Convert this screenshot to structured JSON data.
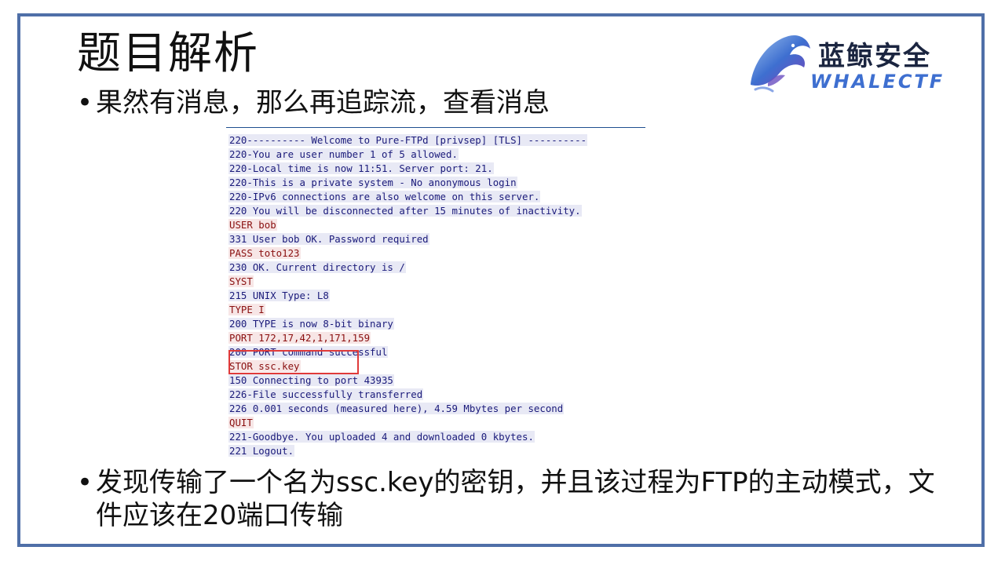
{
  "slide": {
    "title": "题目解析",
    "bullet1": "果然有消息，那么再追踪流，查看消息",
    "bullet2": "发现传输了一个名为ssc.key的密钥，并且该过程为FTP的主动模式，文件应该在20端口传输",
    "bullet_marker": "•"
  },
  "logo": {
    "cn": "蓝鲸安全",
    "en": "WHALECTF",
    "colors": {
      "text": "#1b2540",
      "accent": "#3e6fd0"
    }
  },
  "ftp_stream": {
    "lines": [
      {
        "text": "220---------- Welcome to Pure-FTPd [privsep] [TLS] ----------",
        "dir": "server"
      },
      {
        "text": "220-You are user number 1 of 5 allowed.",
        "dir": "server"
      },
      {
        "text": "220-Local time is now 11:51. Server port: 21.",
        "dir": "server"
      },
      {
        "text": "220-This is a private system - No anonymous login",
        "dir": "server"
      },
      {
        "text": "220-IPv6 connections are also welcome on this server.",
        "dir": "server"
      },
      {
        "text": "220 You will be disconnected after 15 minutes of inactivity.",
        "dir": "server"
      },
      {
        "text": "USER bob",
        "dir": "client"
      },
      {
        "text": "331 User bob OK. Password required",
        "dir": "server"
      },
      {
        "text": "PASS toto123",
        "dir": "client"
      },
      {
        "text": "230 OK. Current directory is /",
        "dir": "server"
      },
      {
        "text": "SYST",
        "dir": "client"
      },
      {
        "text": "215 UNIX Type: L8",
        "dir": "server"
      },
      {
        "text": "TYPE I",
        "dir": "client"
      },
      {
        "text": "200 TYPE is now 8-bit binary",
        "dir": "server"
      },
      {
        "text": "PORT 172,17,42,1,171,159",
        "dir": "client"
      },
      {
        "text": "200 PORT command successful",
        "dir": "server"
      },
      {
        "text": "STOR ssc.key",
        "dir": "client"
      },
      {
        "text": "150 Connecting to port 43935",
        "dir": "server"
      },
      {
        "text": "226-File successfully transferred",
        "dir": "server"
      },
      {
        "text": "226 0.001 seconds (measured here), 4.59 Mbytes per second",
        "dir": "server"
      },
      {
        "text": "QUIT",
        "dir": "client"
      },
      {
        "text": "221-Goodbye. You uploaded 4 and downloaded 0 kbytes.",
        "dir": "server"
      },
      {
        "text": "221 Logout.",
        "dir": "server"
      }
    ],
    "colors": {
      "server_bg": "#e8e9f5",
      "server_fg": "#1a1a7a",
      "client_bg": "#f7e6e6",
      "client_fg": "#8a1010",
      "highlight": "#e03a3a"
    }
  }
}
